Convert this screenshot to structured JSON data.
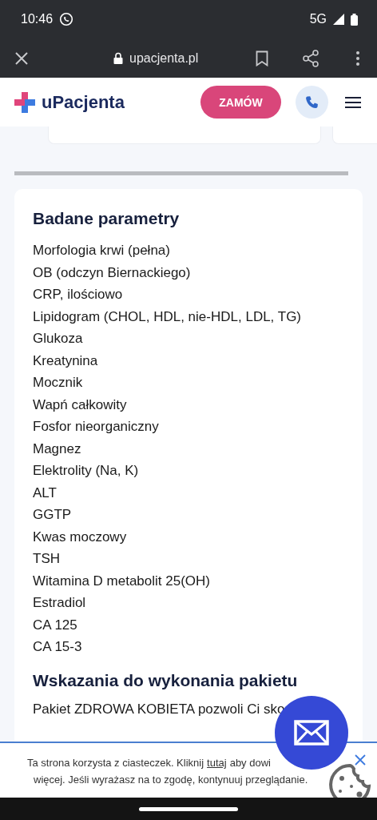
{
  "status_bar": {
    "time": "10:46",
    "network": "5G"
  },
  "browser_bar": {
    "url": "upacjenta.pl"
  },
  "site_header": {
    "logo": "uPacjenta",
    "order_button": "ZAMÓW"
  },
  "section": {
    "title": "Badane parametry",
    "items": [
      "Morfologia krwi (pełna)",
      "OB (odczyn Biernackiego)",
      "CRP, ilościowo",
      "Lipidogram (CHOL, HDL, nie-HDL, LDL, TG)",
      "Glukoza",
      "Kreatynina",
      "Mocznik",
      "Wapń całkowity",
      "Fosfor nieorganiczny",
      "Magnez",
      "Elektrolity (Na, K)",
      "ALT",
      "GGTP",
      "Kwas moczowy",
      "TSH",
      "Witamina D metabolit 25(OH)",
      "Estradiol",
      "CA 125",
      "CA 15-3"
    ]
  },
  "section_2": {
    "title": "Wskazania do wykonania pakietu",
    "text": "Pakiet ZDROWA KOBIETA pozwoli Ci sko"
  },
  "cookie_banner": {
    "line_1_before": "Ta strona korzysta z ciasteczek. Kliknij",
    "link": "tutaj",
    "line_1_after": "aby dowi",
    "line_2": "więcej. Jeśli wyrażasz na to zgodę, kontynuuj przeglądanie."
  }
}
